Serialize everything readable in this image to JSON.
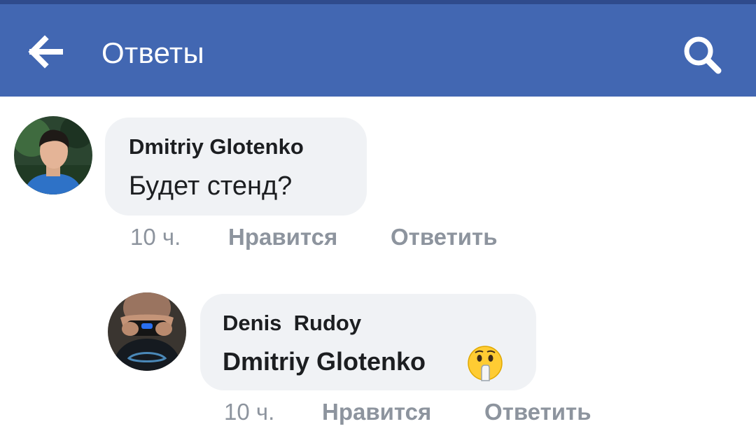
{
  "header": {
    "title": "Ответы",
    "back_icon": "arrow-left-icon",
    "search_icon": "search-icon",
    "background": "#4267b2"
  },
  "comments": [
    {
      "author": "Dmitriy Glotenko",
      "text": "Будет стенд?",
      "time": "10 ч.",
      "like_label": "Нравится",
      "reply_label": "Ответить"
    },
    {
      "author": "Denis  Rudoy",
      "mention": "Dmitriy Glotenko",
      "emoji": "shushing-face-emoji",
      "time": "10 ч.",
      "like_label": "Нравится",
      "reply_label": "Ответить"
    }
  ]
}
